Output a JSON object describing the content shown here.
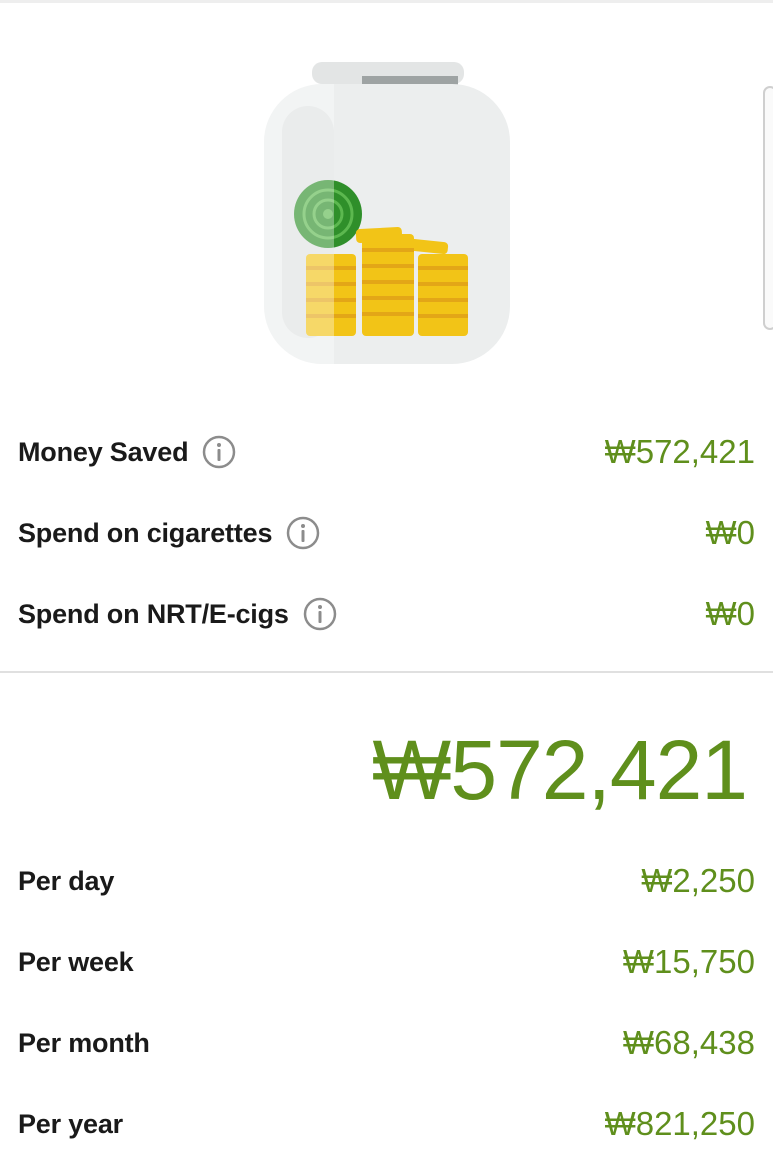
{
  "summary": {
    "items": [
      {
        "label": "Money Saved",
        "value": "₩572,421"
      },
      {
        "label": "Spend on cigarettes",
        "value": "₩0"
      },
      {
        "label": "Spend on NRT/E-cigs",
        "value": "₩0"
      }
    ]
  },
  "total": {
    "value": "₩572,421"
  },
  "rates": [
    {
      "label": "Per day",
      "value": "₩2,250"
    },
    {
      "label": "Per week",
      "value": "₩15,750"
    },
    {
      "label": "Per month",
      "value": "₩68,438"
    },
    {
      "label": "Per year",
      "value": "₩821,250"
    }
  ],
  "colors": {
    "accent": "#5f8f1c",
    "coin": "#f2c417",
    "jar": "#eceeee",
    "lid": "#e3e5e5",
    "pill": "#2f8f2a"
  },
  "icons": {
    "info": "info-circle-icon",
    "jar": "coin-jar-icon"
  }
}
